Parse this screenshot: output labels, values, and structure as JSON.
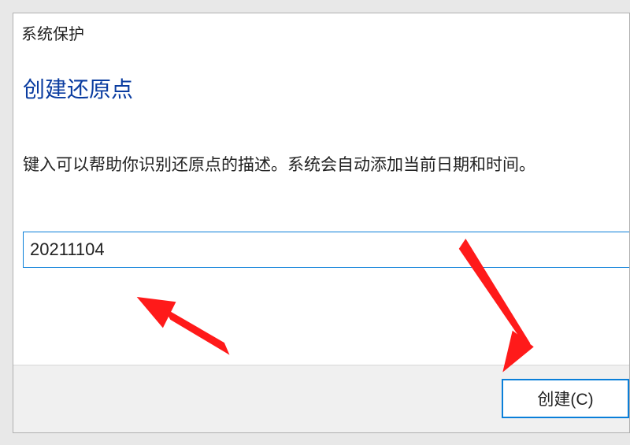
{
  "header": {
    "title": "系统保护"
  },
  "main": {
    "heading": "创建还原点",
    "instruction": "键入可以帮助你识别还原点的描述。系统会自动添加当前日期和时间。",
    "input_value": "20211104"
  },
  "buttons": {
    "create": "创建(C)"
  }
}
